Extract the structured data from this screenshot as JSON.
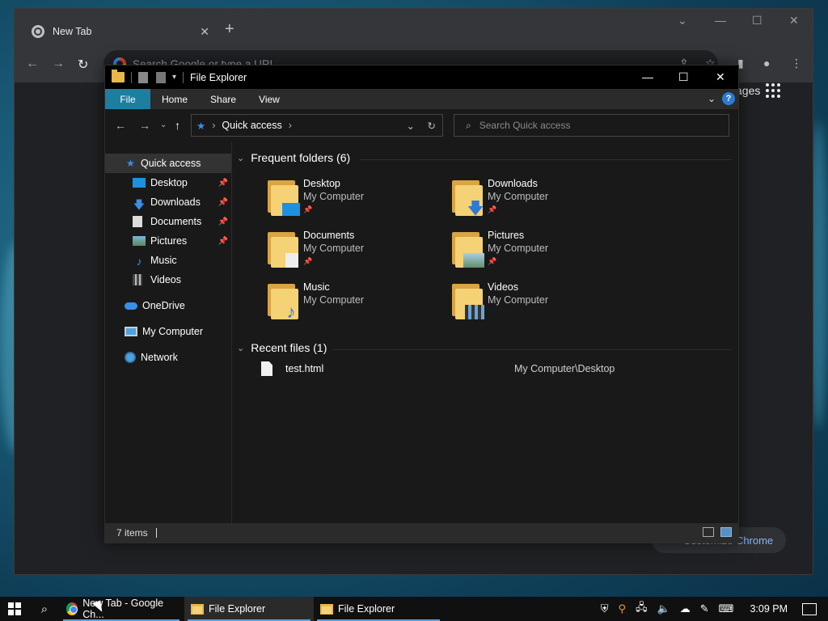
{
  "chrome": {
    "tab_title": "New Tab",
    "omnibox_placeholder": "Search Google or type a URL",
    "images_link": "ages",
    "customize_label": "Customize Chrome"
  },
  "explorer": {
    "title": "File Explorer",
    "ribbon_tabs": [
      "File",
      "Home",
      "Share",
      "View"
    ],
    "address_location": "Quick access",
    "search_placeholder": "Search Quick access",
    "nav_items": [
      {
        "label": "Quick access",
        "icon": "star-icon"
      },
      {
        "label": "Desktop",
        "icon": "desktop-icon"
      },
      {
        "label": "Downloads",
        "icon": "download-icon"
      },
      {
        "label": "Documents",
        "icon": "document-icon"
      },
      {
        "label": "Pictures",
        "icon": "picture-icon"
      },
      {
        "label": "Music",
        "icon": "music-icon"
      },
      {
        "label": "Videos",
        "icon": "video-icon"
      },
      {
        "label": "OneDrive",
        "icon": "cloud-icon"
      },
      {
        "label": "My Computer",
        "icon": "computer-icon"
      },
      {
        "label": "Network",
        "icon": "network-icon"
      }
    ],
    "frequent_header": "Frequent folders (6)",
    "folders": [
      {
        "name": "Desktop",
        "location": "My Computer"
      },
      {
        "name": "Downloads",
        "location": "My Computer"
      },
      {
        "name": "Documents",
        "location": "My Computer"
      },
      {
        "name": "Pictures",
        "location": "My Computer"
      },
      {
        "name": "Music",
        "location": "My Computer"
      },
      {
        "name": "Videos",
        "location": "My Computer"
      }
    ],
    "recent_header": "Recent files (1)",
    "recent_files": [
      {
        "name": "test.html",
        "location": "My Computer\\Desktop"
      }
    ],
    "status_items": "7 items"
  },
  "taskbar": {
    "apps": [
      "New Tab - Google Ch...",
      "File Explorer",
      "File Explorer"
    ],
    "clock": "3:09 PM"
  },
  "colors": {
    "ribbon_file": "#1c7fa0",
    "accent_link": "#8ab4f8",
    "folder_yellow": "#f5d276"
  }
}
